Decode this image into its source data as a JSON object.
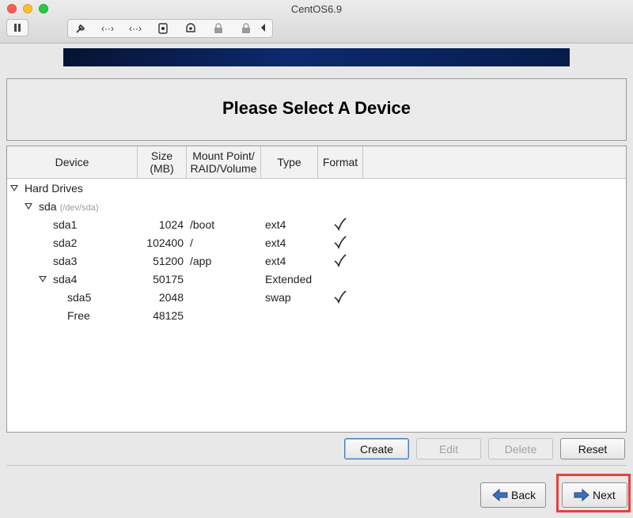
{
  "window": {
    "title": "CentOS6.9"
  },
  "toolbar": {
    "icons": [
      "pause-icon",
      "wrench-icon",
      "network-arrows-icon",
      "network-arrows-icon-2",
      "disk-icon",
      "camera-icon",
      "lock-icon",
      "lock-icon-2",
      "chevron-left-icon"
    ]
  },
  "header": {
    "title": "Please Select A Device"
  },
  "columns": {
    "device": "Device",
    "size": "Size (MB)",
    "mount": "Mount Point/ RAID/Volume",
    "type": "Type",
    "format": "Format"
  },
  "tree": [
    {
      "device": "Hard Drives",
      "sub": "",
      "size": "",
      "mount": "",
      "type": "",
      "format": false,
      "expandable": true
    },
    {
      "device": "sda",
      "sub": "(/dev/sda)",
      "size": "",
      "mount": "",
      "type": "",
      "format": false,
      "expandable": true
    },
    {
      "device": "sda1",
      "sub": "",
      "size": "1024",
      "mount": "/boot",
      "type": "ext4",
      "format": true,
      "expandable": false
    },
    {
      "device": "sda2",
      "sub": "",
      "size": "102400",
      "mount": "/",
      "type": "ext4",
      "format": true,
      "expandable": false
    },
    {
      "device": "sda3",
      "sub": "",
      "size": "51200",
      "mount": "/app",
      "type": "ext4",
      "format": true,
      "expandable": false
    },
    {
      "device": "sda4",
      "sub": "",
      "size": "50175",
      "mount": "",
      "type": "Extended",
      "format": false,
      "expandable": true
    },
    {
      "device": "sda5",
      "sub": "",
      "size": "2048",
      "mount": "",
      "type": "swap",
      "format": true,
      "expandable": false
    },
    {
      "device": "Free",
      "sub": "",
      "size": "48125",
      "mount": "",
      "type": "",
      "format": false,
      "expandable": false
    }
  ],
  "actions": {
    "create": "Create",
    "edit": "Edit",
    "delete": "Delete",
    "reset": "Reset"
  },
  "nav": {
    "back": "Back",
    "next": "Next"
  },
  "colors": {
    "banner": "#0c2a6e",
    "highlight": "#e8403a"
  }
}
